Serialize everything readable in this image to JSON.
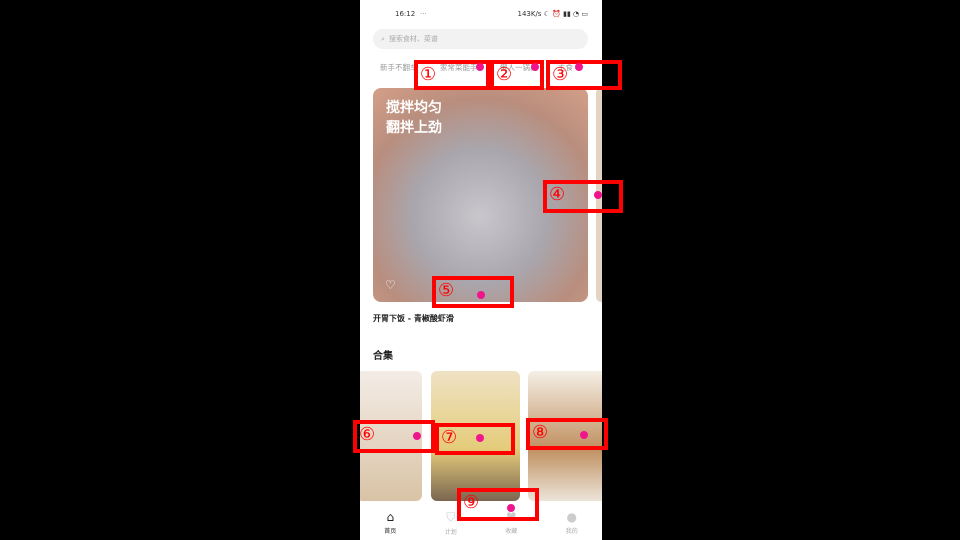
{
  "status": {
    "time": "16:12",
    "dots": "···",
    "right": "143K/s ☾ ⏰ ▮▮ ◔ ▭"
  },
  "search": {
    "placeholder": "搜索食材、菜谱",
    "icon": "search-icon"
  },
  "tabs": [
    "新手不翻车",
    "家常菜能手",
    "懒人一锅出",
    "主食"
  ],
  "feature": {
    "overlay_line1": "搅拌均匀",
    "overlay_line2": "翻拌上劲",
    "title": "开胃下饭 - 青椒酸虾滑"
  },
  "collections": {
    "heading": "合集"
  },
  "nav": [
    {
      "label": "首页",
      "icon": "home-icon"
    },
    {
      "label": "计划",
      "icon": "plan-icon"
    },
    {
      "label": "收藏",
      "icon": "favorite-icon"
    },
    {
      "label": "我的",
      "icon": "profile-icon"
    }
  ],
  "annotations": [
    "①",
    "②",
    "③",
    "④",
    "⑤",
    "⑥",
    "⑦",
    "⑧",
    "⑨"
  ]
}
